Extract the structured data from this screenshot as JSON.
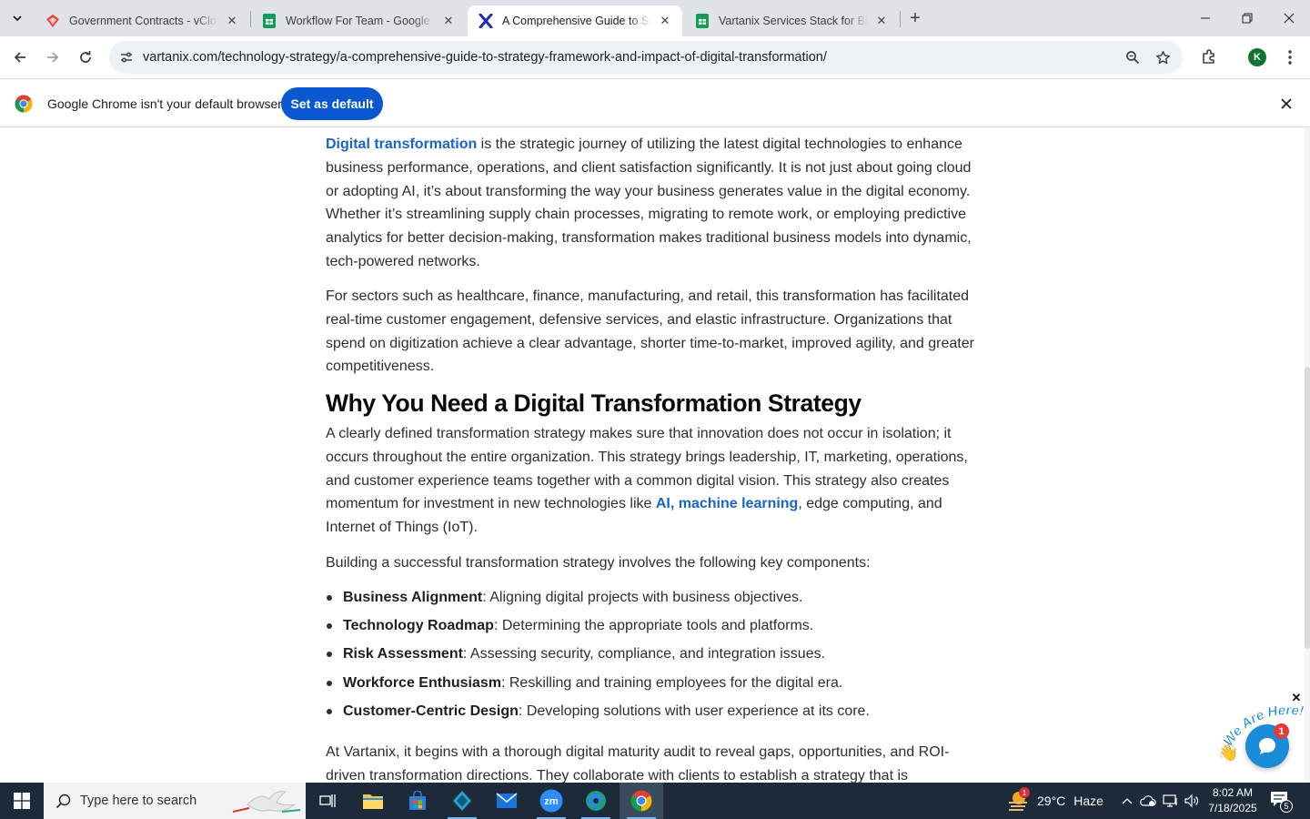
{
  "browser": {
    "tabs": [
      {
        "title": "Government Contracts - vCloud",
        "favicon": "vcloud-diamond-icon",
        "active": false
      },
      {
        "title": "Workflow For Team - Google Sheets",
        "favicon": "google-sheets-icon",
        "active": false
      },
      {
        "title": "A Comprehensive Guide to Strategy",
        "favicon": "vartanix-x-icon",
        "active": true
      },
      {
        "title": "Vartanix Services Stack for Blog",
        "favicon": "google-sheets-icon",
        "active": false
      }
    ],
    "url": "vartanix.com/technology-strategy/a-comprehensive-guide-to-strategy-framework-and-impact-of-digital-transformation/",
    "profile_initial": "K",
    "infobar": {
      "message": "Google Chrome isn't your default browser",
      "button": "Set as default"
    }
  },
  "article": {
    "p1": {
      "link": "Digital transformation",
      "text": " is the strategic journey of utilizing the latest digital technologies to enhance business performance, operations, and client satisfaction significantly. It is not just about going cloud or adopting AI, it’s about transforming the way your business generates value in the digital economy. Whether it’s streamlining supply chain processes, migrating to remote work, or employing predictive analytics for better decision-making, transformation makes traditional business models into dynamic, tech-powered networks."
    },
    "p2": "For sectors such as healthcare, finance, manufacturing, and retail, this transformation has facilitated real-time customer engagement, defensive services, and elastic infrastructure. Organizations that spend on digitization achieve a clear advantage, shorter time-to-market, improved agility, and greater competitiveness.",
    "heading": "Why You Need a Digital Transformation Strategy",
    "p3": {
      "text_before": "A clearly defined transformation strategy makes sure that innovation does not occur in isolation; it occurs throughout the entire organization. This strategy brings leadership, IT, marketing, operations, and customer experience teams together with a common digital vision. This strategy also creates momentum for investment in new technologies like ",
      "link_ai": "AI",
      "comma": ", ",
      "link_ml": "machine learning",
      "text_after": ", edge computing, and Internet of Things (IoT)."
    },
    "p4": "Building a successful transformation strategy involves the following key components:",
    "components": [
      {
        "term": "Business Alignment",
        "desc": ": Aligning digital projects with business objectives."
      },
      {
        "term": "Technology Roadmap",
        "desc": ": Determining the appropriate tools and platforms."
      },
      {
        "term": "Risk Assessment",
        "desc": ": Assessing security, compliance, and integration issues."
      },
      {
        "term": "Workforce Enthusiasm",
        "desc": ": Reskilling and training employees for the digital era."
      },
      {
        "term": "Customer-Centric Design",
        "desc": ": Developing solutions with user experience at its core."
      }
    ],
    "p5": "At Vartanix, it begins with a thorough digital maturity audit to reveal gaps, opportunities, and ROI-driven transformation directions. They collaborate with clients to establish a strategy that is"
  },
  "chat_widget": {
    "badge_text": "We Are Here!",
    "unread_count": "1"
  },
  "taskbar": {
    "search_placeholder": "Type here to search",
    "weather": {
      "temp": "29°C",
      "condition": "Haze",
      "alert_count": "1"
    },
    "clock": {
      "time": "8:02 AM",
      "date": "7/18/2025"
    },
    "notification_count": "5"
  },
  "colors": {
    "link": "#1a64c7",
    "primary_button": "#0b57d0",
    "taskbar": "#1c2a3a"
  }
}
